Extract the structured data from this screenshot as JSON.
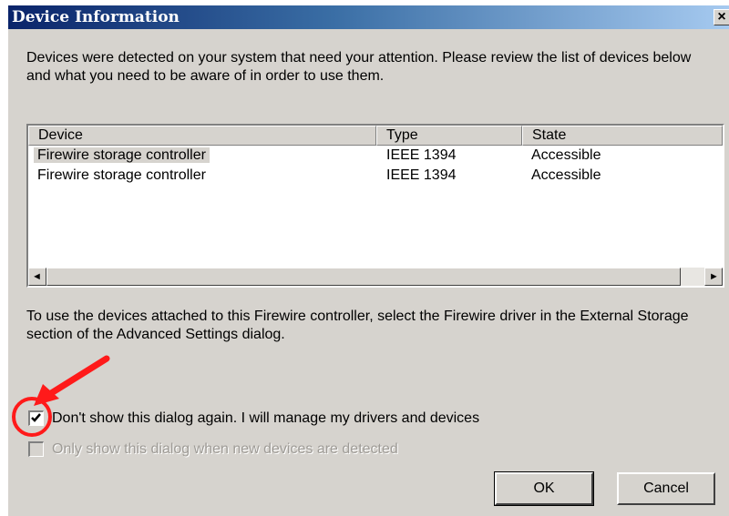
{
  "window": {
    "title": "Device Information",
    "close_glyph": "×"
  },
  "intro_text": "Devices were detected on your system that need your attention. Please review the list of devices below and what you need to be aware of in order to use them.",
  "device_list": {
    "columns": [
      "Device",
      "Type",
      "State"
    ],
    "rows": [
      {
        "device": "Firewire storage controller",
        "type": "IEEE 1394",
        "state": "Accessible",
        "selected": true
      },
      {
        "device": "Firewire storage controller",
        "type": "IEEE 1394",
        "state": "Accessible",
        "selected": false
      }
    ],
    "scroll_left_glyph": "◄",
    "scroll_right_glyph": "►"
  },
  "note_text": "To use the devices attached to this Firewire controller, select the Firewire driver in the External Storage section of the Advanced Settings dialog.",
  "options": {
    "dont_show_again": {
      "label": "Don't show this dialog again. I will manage my drivers and devices",
      "checked": true,
      "enabled": true
    },
    "only_show_new": {
      "label": "Only show this dialog when new devices are detected",
      "checked": false,
      "enabled": false
    }
  },
  "buttons": {
    "ok": "OK",
    "cancel": "Cancel"
  },
  "annotation": {
    "color": "#ff1a1a",
    "icons": [
      "red-arrow-icon",
      "red-circle-highlight"
    ]
  },
  "colors": {
    "title_start": "#0a246a",
    "title_end": "#a6caf0",
    "dialog_bg": "#d6d3ce"
  }
}
